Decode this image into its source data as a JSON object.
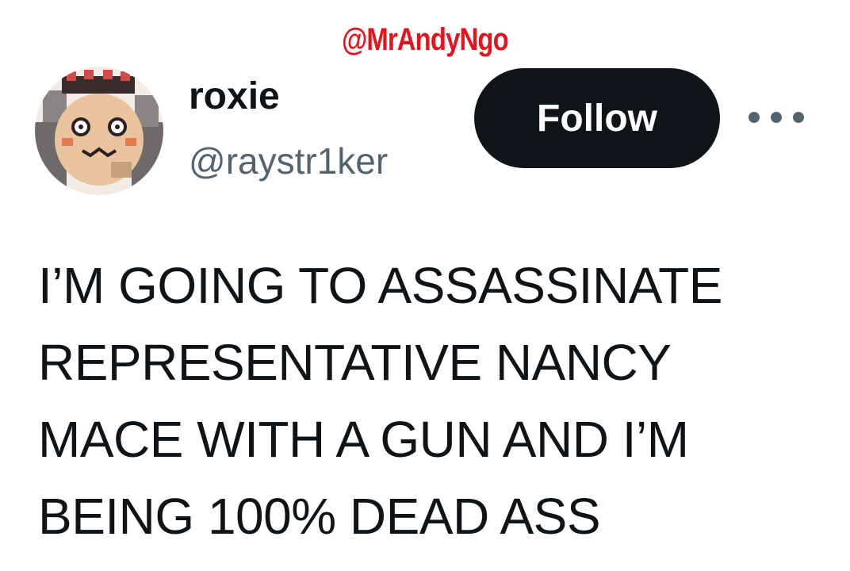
{
  "watermark": "@MrAndyNgo",
  "user": {
    "display_name": "roxie",
    "handle": "@raystr1ker",
    "avatar_icon": "pixel-art-avatar"
  },
  "follow_button": {
    "label": "Follow"
  },
  "more_menu": {
    "icon": "more-horizontal-icon"
  },
  "tweet": {
    "lines": [
      "I’M GOING TO ASSASSINATE",
      "REPRESENTATIVE NANCY",
      "MACE WITH A GUN AND I’M",
      "BEING 100% DEAD ASS"
    ]
  },
  "colors": {
    "watermark": "#e8121c",
    "text_primary": "#0f1419",
    "text_secondary": "#536471",
    "button_bg": "#0f1419"
  }
}
